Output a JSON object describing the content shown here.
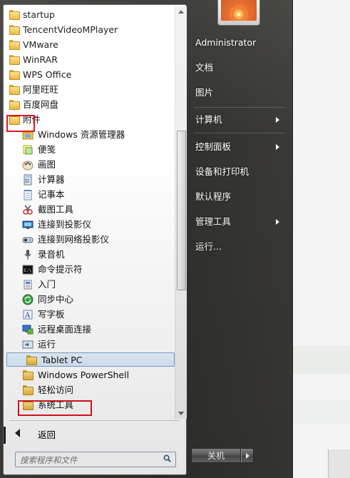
{
  "programs": {
    "items": [
      {
        "label": "startup",
        "icon": "folder-icon"
      },
      {
        "label": "TencentVideoMPlayer",
        "icon": "folder-icon"
      },
      {
        "label": "VMware",
        "icon": "folder-icon"
      },
      {
        "label": "WinRAR",
        "icon": "folder-icon"
      },
      {
        "label": "WPS Office",
        "icon": "folder-icon"
      },
      {
        "label": "阿里旺旺",
        "icon": "folder-icon"
      },
      {
        "label": "百度网盘",
        "icon": "folder-icon"
      },
      {
        "label": "附件",
        "icon": "open-folder-icon"
      }
    ],
    "accessories": [
      {
        "label": "Windows 资源管理器",
        "icon": "explorer-icon"
      },
      {
        "label": "便笺",
        "icon": "sticky-notes-icon"
      },
      {
        "label": "画图",
        "icon": "paint-icon"
      },
      {
        "label": "计算器",
        "icon": "calculator-icon"
      },
      {
        "label": "记事本",
        "icon": "notepad-icon"
      },
      {
        "label": "截图工具",
        "icon": "snipping-tool-icon"
      },
      {
        "label": "连接到投影仪",
        "icon": "projector-icon"
      },
      {
        "label": "连接到网络投影仪",
        "icon": "network-projector-icon"
      },
      {
        "label": "录音机",
        "icon": "sound-recorder-icon"
      },
      {
        "label": "命令提示符",
        "icon": "command-prompt-icon"
      },
      {
        "label": "入门",
        "icon": "getting-started-icon"
      },
      {
        "label": "同步中心",
        "icon": "sync-center-icon"
      },
      {
        "label": "写字板",
        "icon": "wordpad-icon"
      },
      {
        "label": "远程桌面连接",
        "icon": "remote-desktop-icon"
      },
      {
        "label": "运行",
        "icon": "run-icon"
      }
    ],
    "subfolders": [
      {
        "label": "Tablet PC",
        "icon": "folder-icon"
      },
      {
        "label": "Windows PowerShell",
        "icon": "folder-icon"
      },
      {
        "label": "轻松访问",
        "icon": "folder-icon"
      },
      {
        "label": "系统工具",
        "icon": "folder-icon"
      }
    ]
  },
  "back_label": "返回",
  "search": {
    "placeholder": "搜索程序和文件"
  },
  "right_pane": {
    "items": [
      {
        "label": "Administrator",
        "submenu": false
      },
      {
        "label": "文档",
        "submenu": false
      },
      {
        "label": "图片",
        "submenu": false
      },
      {
        "label": "计算机",
        "submenu": true
      },
      {
        "label": "控制面板",
        "submenu": true
      },
      {
        "label": "设备和打印机",
        "submenu": false
      },
      {
        "label": "默认程序",
        "submenu": false
      },
      {
        "label": "管理工具",
        "submenu": true
      },
      {
        "label": "运行...",
        "submenu": false
      }
    ]
  },
  "shutdown_label": "关机",
  "colors": {
    "highlight_border": "#e0141e",
    "selection": "#d9ebfc"
  }
}
